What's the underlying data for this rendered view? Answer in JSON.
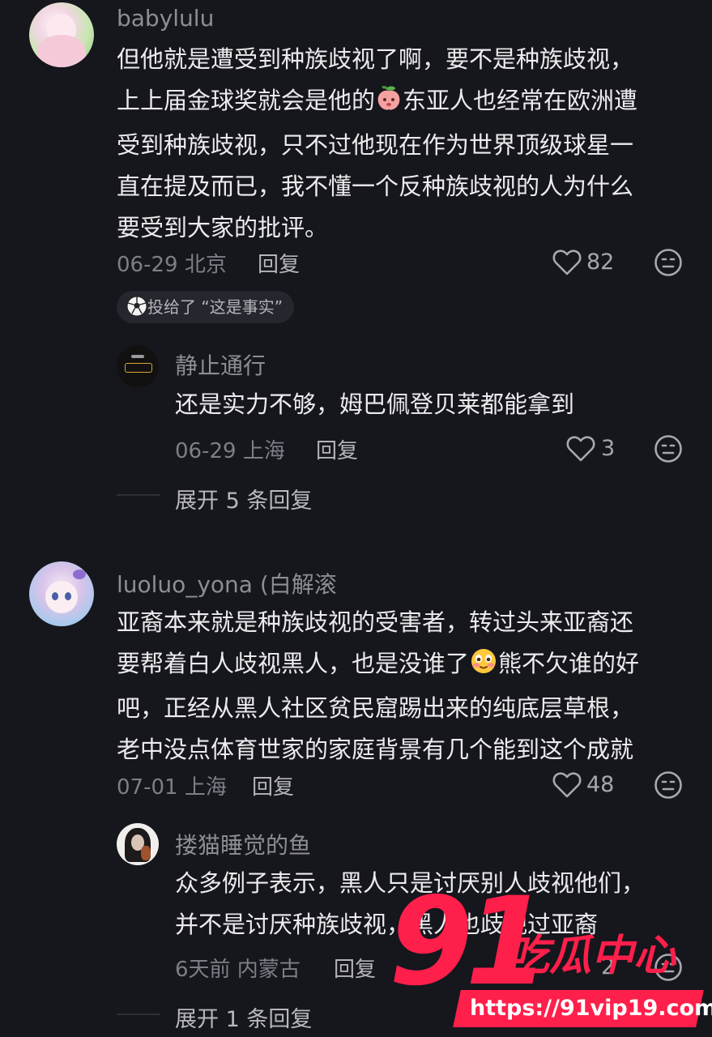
{
  "comments": [
    {
      "username": "babylulu",
      "lines": [
        "但他就是遭受到种族歧视了啊，要不是种族歧视，",
        "上上届金球奖就会是他的",
        "东亚人也经常在欧洲遭",
        "受到种族歧视，只不过他现在作为世界顶级球星一",
        "直在提及而已，我不懂一个反种族歧视的人为什么",
        "要受到大家的批评。"
      ],
      "date_location": "06-29 北京",
      "reply_label": "回复",
      "likes": "82",
      "vote_badge": "投给了 “这是事实”",
      "reply": {
        "username": "静止通行",
        "text": "还是实力不够，姆巴佩登贝莱都能拿到",
        "date_location": "06-29 上海",
        "reply_label": "回复",
        "likes": "3"
      },
      "expand_label": "展开 5 条回复"
    },
    {
      "username": "luoluo_yona (白解滚",
      "lines": [
        "亚裔本来就是种族歧视的受害者，转过头来亚裔还",
        "要帮着白人歧视黑人，也是没谁了",
        "熊不欠谁的好",
        "吧，正经从黑人社区贫民窟踢出来的纯底层草根，",
        "老中没点体育世家的家庭背景有几个能到这个成就"
      ],
      "date_location": "07-01 上海",
      "reply_label": "回复",
      "likes": "48",
      "reply": {
        "username": "搂猫睡觉的鱼",
        "lines": [
          "众多例子表示，黑人只是讨厌别人歧视他们，",
          "并不是讨厌种族歧视，黑人也歧视过亚裔"
        ],
        "date_location": "6天前 内蒙古",
        "reply_label": "回复",
        "likes": "2"
      },
      "expand_label": "展开 1 条回复"
    }
  ],
  "watermark": {
    "number": "91",
    "brand": "吃瓜中心",
    "url": "https://91vip19.com"
  },
  "colors": {
    "background": "#16161d",
    "username": "#8d8d94",
    "text": "#ececee",
    "watermark": "#ff1f4b"
  },
  "icons": [
    "heart-icon",
    "emoji-react-icon",
    "soccer-ball-icon",
    "peach-emoji",
    "blush-emoji"
  ]
}
